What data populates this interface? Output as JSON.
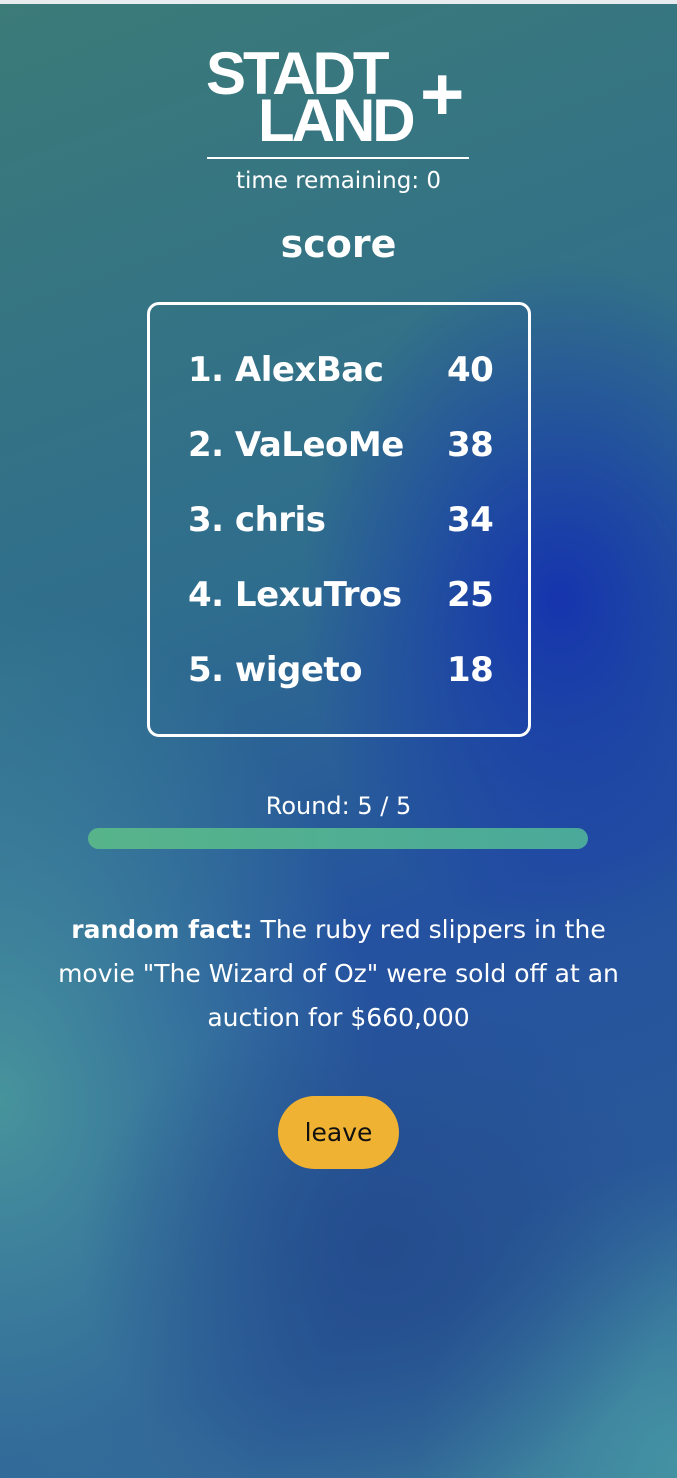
{
  "logo": {
    "line1": "STADT",
    "line2": "LAND",
    "plus": "+"
  },
  "timer": {
    "text": "time remaining: 0"
  },
  "score": {
    "title": "score",
    "players": [
      {
        "rank_name": "1. AlexBac",
        "points": "40"
      },
      {
        "rank_name": "2. VaLeoMe",
        "points": "38"
      },
      {
        "rank_name": "3. chris",
        "points": "34"
      },
      {
        "rank_name": "4. LexuTros",
        "points": "25"
      },
      {
        "rank_name": "5. wigeto",
        "points": "18"
      }
    ]
  },
  "round": {
    "text": "Round: 5 / 5",
    "progress": 1.0
  },
  "fact": {
    "label": "random fact:",
    "text": " The ruby red slippers in the movie \"The Wizard of Oz\" were sold off at an auction for $660,000"
  },
  "actions": {
    "leave_label": "leave"
  },
  "colors": {
    "accent_button": "#f0b232",
    "progress": "#57b48a"
  }
}
